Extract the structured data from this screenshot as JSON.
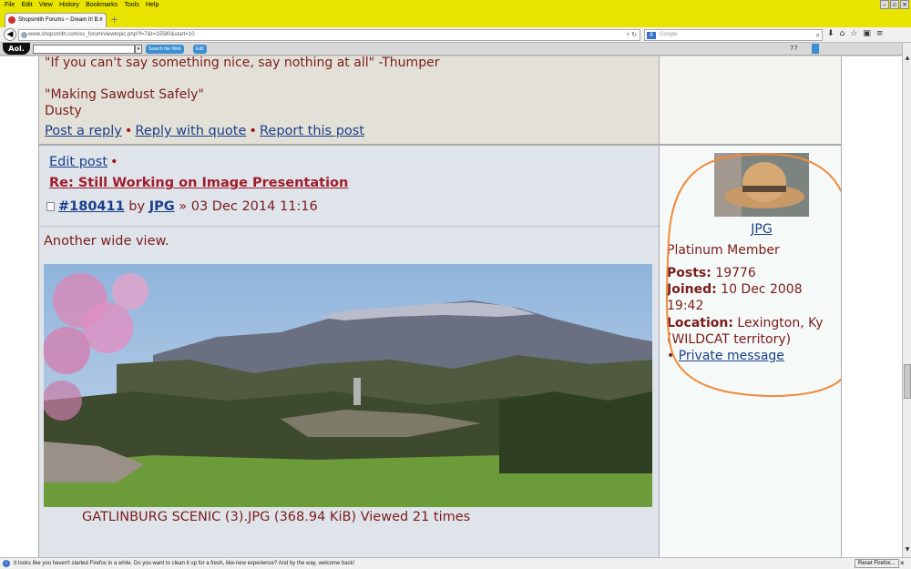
{
  "browser": {
    "menu": [
      "File",
      "Edit",
      "View",
      "History",
      "Bookmarks",
      "Tools",
      "Help"
    ],
    "tab_title": "Shopsmith Forums ~ Dream It! B...",
    "url": "www.shopsmith.com/ss_forum/viewtopic.php?f=7&t=15580&start=10",
    "search_placeholder": "Google",
    "search_engine_letter": "8",
    "aol_logo": "Aol.",
    "aol_search_button": "Search the Web",
    "aol_edit_button": "Edit",
    "aol_count": "77",
    "status_message": "It looks like you haven't started Firefox in a while. Do you want to clean it up for a fresh, like-new experience? And by the way, welcome back!",
    "reset_button": "Reset Firefox..."
  },
  "post1": {
    "sig_quote": "\"If you can't say something nice, say nothing at all\" -Thumper",
    "sig_motto": "\"Making Sawdust Safely\"",
    "sig_name": "Dusty",
    "actions": {
      "reply": "Post a reply",
      "quote": "Reply with quote",
      "report": "Report this post"
    }
  },
  "post2": {
    "edit_link": "Edit post",
    "subject": "Re: Still Working on Image Presentation",
    "post_id": "#180411",
    "by": "by",
    "author": "JPG",
    "date": "» 03 Dec 2014 11:16",
    "body": "Another wide view.",
    "attachment_caption": "GATLINBURG SCENIC (3).JPG (368.94 KiB) Viewed 21 times"
  },
  "profile": {
    "username": "JPG",
    "rank": "Platinum Member",
    "posts_label": "Posts:",
    "posts_value": "19776",
    "joined_label": "Joined:",
    "joined_value": "10 Dec 2008",
    "joined_time": "19:42",
    "location_label": "Location:",
    "location_value": "Lexington, Ky",
    "location_extra": "(WILDCAT territory)",
    "pm_link": "Private message"
  },
  "colors": {
    "menubar": "#e8e400",
    "post_text": "#7a1c1c",
    "link": "#1a3f8a",
    "subject": "#a01c2c",
    "annotation": "#f08a3c"
  }
}
